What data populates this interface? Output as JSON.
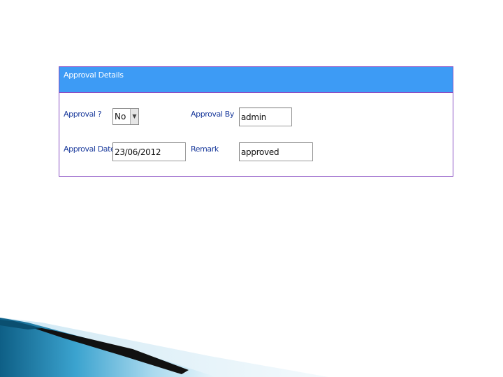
{
  "panel": {
    "title": "Approval Details"
  },
  "form": {
    "approval": {
      "label": "Approval ?",
      "value": "No"
    },
    "approval_by": {
      "label": "Approval By",
      "value": "admin"
    },
    "approval_date": {
      "label": "Approval Date",
      "value": "23/06/2012"
    },
    "remark": {
      "label": "Remark",
      "value": "approved"
    }
  },
  "icons": {
    "dropdown": "chevron-down-icon"
  },
  "colors": {
    "header": "#3d9bf5",
    "border": "#8a4fc4",
    "label": "#1a3a9c"
  }
}
